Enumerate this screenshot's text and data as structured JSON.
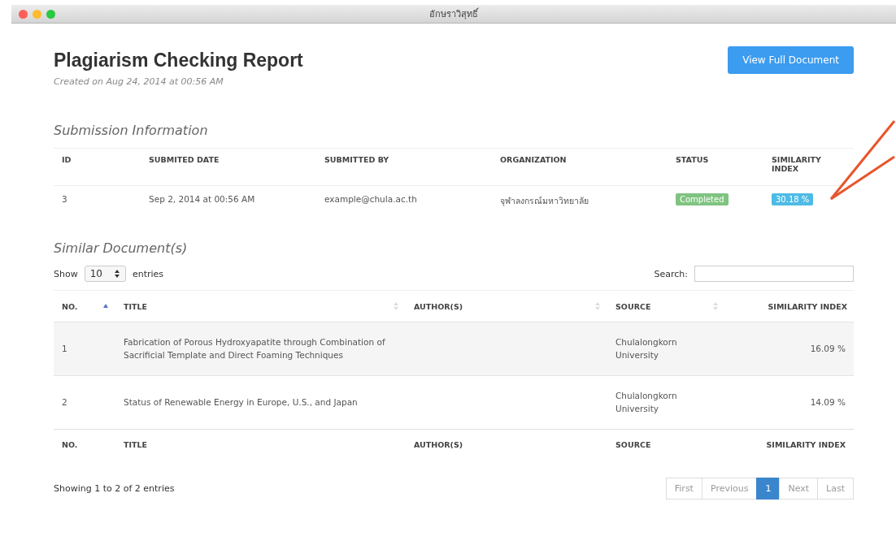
{
  "window": {
    "title": "อักษราวิสุทธิ์"
  },
  "header": {
    "title": "Plagiarism Checking Report",
    "created": "Created on Aug 24, 2014 at 00:56 AM",
    "button": "View Full Document"
  },
  "submission": {
    "heading": "Submission Information",
    "columns": [
      "ID",
      "SUBMITED DATE",
      "SUBMITTED BY",
      "ORGANIZATION",
      "STATUS",
      "SIMILARITY INDEX"
    ],
    "row": {
      "id": "3",
      "date": "Sep 2, 2014 at 00:56 AM",
      "by": "example@chula.ac.th",
      "organization": "จุฬาลงกรณ์มหาวิทยาลัย",
      "status": "Completed",
      "similarity": "30.18 %"
    }
  },
  "similar": {
    "heading": "Similar Document(s)",
    "show_label": "Show",
    "page_size": "10",
    "entries_label": "entries",
    "search_label": "Search:",
    "columns": [
      {
        "label": "NO.",
        "sorted": true
      },
      {
        "label": "TITLE",
        "sorted": false
      },
      {
        "label": "AUTHOR(S)",
        "sorted": false
      },
      {
        "label": "SOURCE",
        "sorted": false
      },
      {
        "label": "SIMILARITY INDEX"
      }
    ],
    "rows": [
      {
        "no": "1",
        "title": "Fabrication of Porous Hydroxyapatite through Combination of Sacrificial Template and Direct Foaming Techniques",
        "source": "Chulalongkorn University",
        "similarity": "16.09 %"
      },
      {
        "no": "2",
        "title": "Status of Renewable Energy in Europe, U.S., and Japan",
        "source": "Chulalongkorn University",
        "similarity": "14.09 %"
      }
    ],
    "footer_columns": [
      "NO.",
      "TITLE",
      "AUTHOR(S)",
      "SOURCE",
      "SIMILARITY INDEX"
    ],
    "info": "Showing 1 to 2 of 2 entries",
    "pagination": [
      {
        "label": "First",
        "selected": false
      },
      {
        "label": "Previous",
        "selected": false
      },
      {
        "label": "1",
        "selected": true
      },
      {
        "label": "Next",
        "selected": false
      },
      {
        "label": "Last",
        "selected": false
      }
    ]
  }
}
